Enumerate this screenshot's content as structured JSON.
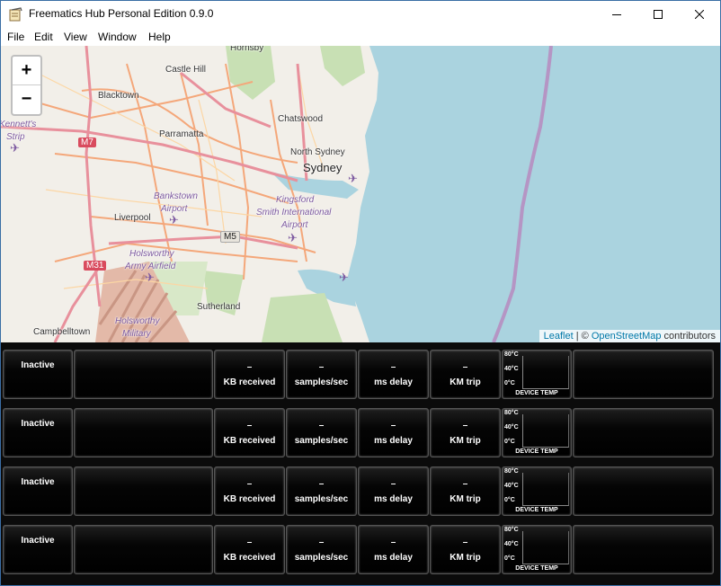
{
  "window": {
    "title": "Freematics Hub Personal Edition 0.9.0",
    "icons": {
      "app": "notepad-icon",
      "minimize": "minimize-icon",
      "maximize": "maximize-icon",
      "close": "close-icon"
    }
  },
  "menu": {
    "items": [
      "File",
      "Edit",
      "View",
      "Window",
      "Help"
    ]
  },
  "map": {
    "zoom_in": "+",
    "zoom_out": "−",
    "attribution": {
      "leaflet": "Leaflet",
      "sep": " | © ",
      "osm": "OpenStreetMap",
      "suffix": " contributors"
    },
    "places": {
      "hornsby": "Hornsby",
      "castle_hill": "Castle Hill",
      "blacktown": "Blacktown",
      "parramatta": "Parramatta",
      "chatswood": "Chatswood",
      "north_sydney": "North Sydney",
      "sydney": "Sydney",
      "kennetts": "Kennett's",
      "strip": "Strip",
      "bankstown": "Bankstown",
      "airport": "Airport",
      "kingsford": "Kingsford",
      "smith_international": "Smith International",
      "airport2": "Airport",
      "liverpool": "Liverpool",
      "holsworthy_army": "Holsworthy",
      "army_airfield": "Army Airfield",
      "sutherland": "Sutherland",
      "holsworthy_military": "Holsworthy",
      "military": "Military",
      "campbelltown": "Campbelltown"
    },
    "roads": {
      "m7": "M7",
      "m5": "M5",
      "m31": "M31"
    },
    "colors": {
      "water": "#aad3df",
      "land": "#f2efe9",
      "park": "#c8e0b4",
      "road": "#f4a77a",
      "motorway": "#e8909c"
    }
  },
  "devices": [
    {
      "status": "Inactive",
      "kb": "–",
      "samples": "–",
      "delay": "–",
      "km": "–"
    },
    {
      "status": "Inactive",
      "kb": "–",
      "samples": "–",
      "delay": "–",
      "km": "–"
    },
    {
      "status": "Inactive",
      "kb": "–",
      "samples": "–",
      "delay": "–",
      "km": "–"
    },
    {
      "status": "Inactive",
      "kb": "–",
      "samples": "–",
      "delay": "–",
      "km": "–"
    }
  ],
  "labels": {
    "kb": "KB received",
    "samples": "samples/sec",
    "delay": "ms delay",
    "km": "KM trip",
    "t80": "80°C",
    "t40": "40°C",
    "t0": "0°C",
    "temp": "DEVICE TEMP"
  }
}
